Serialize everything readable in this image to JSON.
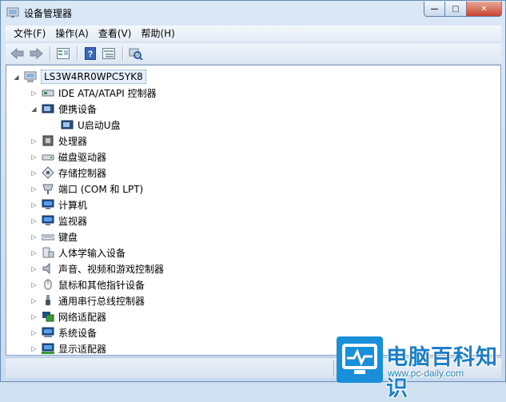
{
  "window": {
    "title": "设备管理器"
  },
  "caption": {
    "minimize": "—",
    "maximize": "□",
    "close": "✕"
  },
  "menu": [
    "文件(F)",
    "操作(A)",
    "查看(V)",
    "帮助(H)"
  ],
  "toolbar": {
    "icons": [
      "back-arrow-icon",
      "forward-arrow-icon",
      "properties-icon",
      "help-icon",
      "view-icon",
      "scan-hardware-icon"
    ]
  },
  "tree": {
    "root": "LS3W4RR0WPC5YK8",
    "items": [
      {
        "label": "IDE ATA/ATAPI 控制器",
        "icon": "ide-controller-icon",
        "expanded": false
      },
      {
        "label": "便携设备",
        "icon": "portable-device-icon",
        "expanded": true
      },
      {
        "label": "U启动U盘",
        "icon": "usb-drive-icon",
        "child": true
      },
      {
        "label": "处理器",
        "icon": "processor-icon",
        "expanded": false
      },
      {
        "label": "磁盘驱动器",
        "icon": "disk-drive-icon",
        "expanded": false
      },
      {
        "label": "存储控制器",
        "icon": "storage-controller-icon",
        "expanded": false
      },
      {
        "label": "端口 (COM 和 LPT)",
        "icon": "port-icon",
        "expanded": false
      },
      {
        "label": "计算机",
        "icon": "computer-icon",
        "expanded": false
      },
      {
        "label": "监视器",
        "icon": "monitor-icon",
        "expanded": false
      },
      {
        "label": "键盘",
        "icon": "keyboard-icon",
        "expanded": false
      },
      {
        "label": "人体学输入设备",
        "icon": "hid-icon",
        "expanded": false
      },
      {
        "label": "声音、视频和游戏控制器",
        "icon": "sound-icon",
        "expanded": false
      },
      {
        "label": "鼠标和其他指针设备",
        "icon": "mouse-icon",
        "expanded": false
      },
      {
        "label": "通用串行总线控制器",
        "icon": "usb-controller-icon",
        "expanded": false
      },
      {
        "label": "网络适配器",
        "icon": "network-adapter-icon",
        "expanded": false
      },
      {
        "label": "系统设备",
        "icon": "system-device-icon",
        "expanded": false
      },
      {
        "label": "显示适配器",
        "icon": "display-adapter-icon",
        "expanded": false
      }
    ]
  },
  "watermark": {
    "title": "电脑百科知识",
    "url": "www.pc-daily.com"
  },
  "colors": {
    "accent": "#1c7fc8",
    "selection": "#e5eefb"
  }
}
